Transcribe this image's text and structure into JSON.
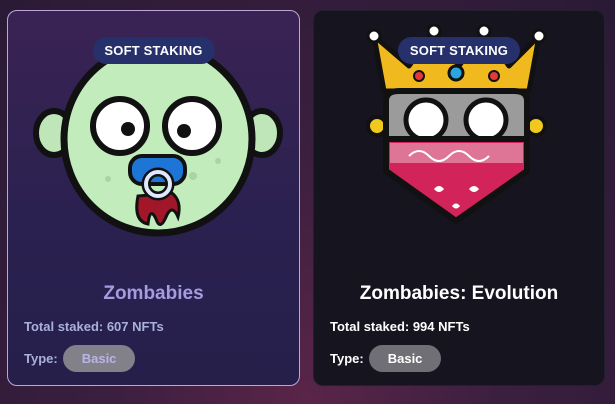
{
  "cards": [
    {
      "badge": "SOFT STAKING",
      "title": "Zombabies",
      "staked": "Total staked: 607 NFTs",
      "type_label": "Type:",
      "type_value": "Basic",
      "art_icon": "zombie-baby-pacifier-icon"
    },
    {
      "badge": "SOFT STAKING",
      "title": "Zombabies: Evolution",
      "staked": "Total staked: 994 NFTs",
      "type_label": "Type:",
      "type_value": "Basic",
      "art_icon": "zombie-king-bandana-icon"
    }
  ],
  "colors": {
    "selected_border": "#b9a7d8",
    "badge_bg": "#26306a",
    "chip_bg": "#7d7d85"
  }
}
